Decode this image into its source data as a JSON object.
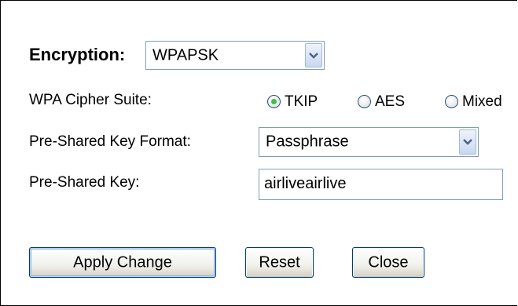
{
  "encryption": {
    "label": "Encryption:",
    "selected": "WPAPSK"
  },
  "cipher": {
    "label": "WPA Cipher Suite:",
    "options": [
      {
        "label": "TKIP",
        "checked": true
      },
      {
        "label": "AES",
        "checked": false
      },
      {
        "label": "Mixed",
        "checked": false
      }
    ]
  },
  "key_format": {
    "label": "Pre-Shared Key Format:",
    "selected": "Passphrase"
  },
  "psk": {
    "label": "Pre-Shared Key:",
    "value": "airliveairlive"
  },
  "buttons": {
    "apply": "Apply Change",
    "reset": "Reset",
    "close": "Close"
  },
  "colors": {
    "radio_selected": "#3fbf3f",
    "button_border": "#003c74",
    "input_border": "#7f9db9"
  }
}
